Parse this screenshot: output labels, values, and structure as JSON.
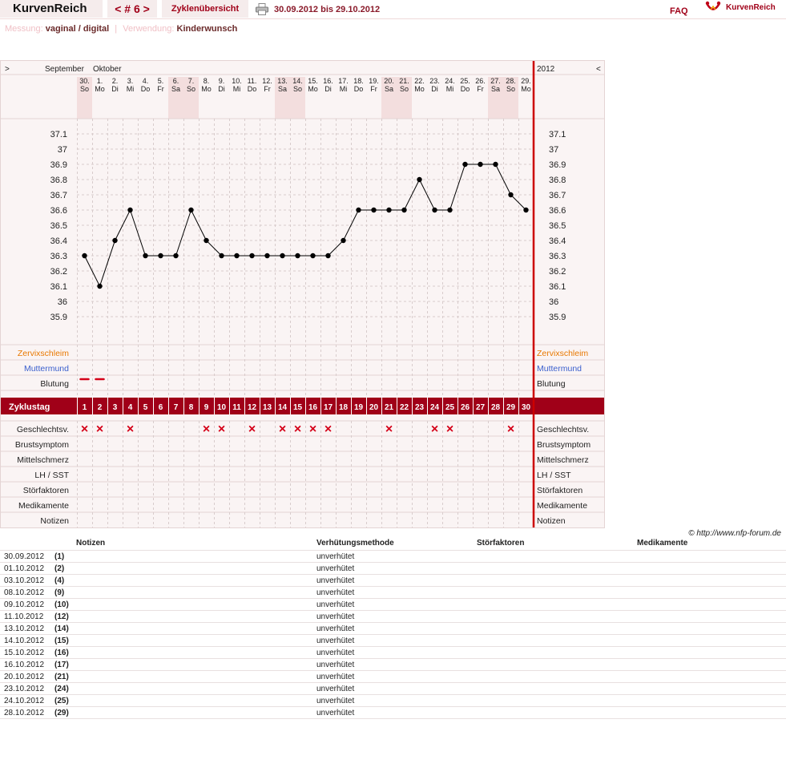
{
  "header": {
    "brand": "KurvenReich",
    "cycle": "< # 6 >",
    "overview": "Zyklenübersicht",
    "range": "30.09.2012 bis 29.10.2012",
    "faq": "FAQ",
    "logo_text": "KurvenReich",
    "printer_icon": "printer-icon",
    "logo_icon": "kurvenreich-logo-icon"
  },
  "meta": {
    "measure_label": "Messung:",
    "measure_value": "vaginal / digital",
    "separator": "|",
    "use_label": "Verwendung:",
    "use_value": "Kinderwunsch"
  },
  "colors": {
    "accent": "#a00018",
    "weekend": "#f3dede",
    "cervical": "#e87800",
    "cervix": "#3a5fcd",
    "curve": "#000000"
  },
  "chart_data": {
    "type": "line",
    "title": "",
    "nav_prev": ">",
    "nav_next": "<",
    "months": [
      "September",
      "Oktober"
    ],
    "year": "2012",
    "dates": [
      "30.",
      "1.",
      "2.",
      "3.",
      "4.",
      "5.",
      "6.",
      "7.",
      "8.",
      "9.",
      "10.",
      "11.",
      "12.",
      "13.",
      "14.",
      "15.",
      "16.",
      "17.",
      "18.",
      "19.",
      "20.",
      "21.",
      "22.",
      "23.",
      "24.",
      "25.",
      "26.",
      "27.",
      "28.",
      "29."
    ],
    "weekdays": [
      "So",
      "Mo",
      "Di",
      "Mi",
      "Do",
      "Fr",
      "Sa",
      "So",
      "Mo",
      "Di",
      "Mi",
      "Do",
      "Fr",
      "Sa",
      "So",
      "Mo",
      "Di",
      "Mi",
      "Do",
      "Fr",
      "Sa",
      "So",
      "Mo",
      "Di",
      "Mi",
      "Do",
      "Fr",
      "Sa",
      "So",
      "Mo"
    ],
    "y_ticks": [
      "37.1",
      "37",
      "36.9",
      "36.8",
      "36.7",
      "36.6",
      "36.5",
      "36.4",
      "36.3",
      "36.2",
      "36.1",
      "36",
      "35.9"
    ],
    "ylim": [
      35.8,
      37.2
    ],
    "x": [
      1,
      2,
      3,
      4,
      5,
      6,
      7,
      8,
      9,
      10,
      11,
      12,
      13,
      14,
      15,
      16,
      17,
      18,
      19,
      20,
      21,
      22,
      23,
      24,
      25,
      26,
      27,
      28,
      29,
      30
    ],
    "series": [
      {
        "values": [
          36.3,
          36.1,
          36.4,
          36.6,
          36.3,
          36.3,
          36.3,
          36.6,
          36.4,
          36.3,
          36.3,
          36.3,
          36.3,
          36.3,
          36.3,
          36.3,
          36.3,
          36.4,
          36.6,
          36.6,
          36.6,
          36.6,
          36.8,
          36.6,
          36.6,
          36.9,
          36.9,
          36.9,
          36.7,
          36.6
        ]
      }
    ],
    "row_labels": {
      "cervical_mucus": "Zervixschleim",
      "cervix": "Muttermund",
      "bleeding": "Blutung",
      "cycle_day": "Zyklustag",
      "intercourse": "Geschlechtsv.",
      "breast": "Brustsymptom",
      "mittelschmerz": "Mittelschmerz",
      "lh": "LH / SST",
      "disturbances": "Störfaktoren",
      "medication": "Medikamente",
      "notes": "Notizen"
    },
    "bleeding_days": [
      1,
      2
    ],
    "intercourse_days": [
      1,
      2,
      4,
      9,
      10,
      12,
      14,
      15,
      16,
      17,
      21,
      24,
      25,
      29
    ],
    "intercourse_mark": "×"
  },
  "copyright": "© http://www.nfp-forum.de",
  "notes_table": {
    "headers": {
      "notes": "Notizen",
      "method": "Verhütungsmethode",
      "disturbances": "Störfaktoren",
      "medication": "Medikamente"
    },
    "rows": [
      {
        "date": "30.09.2012",
        "day": "(1)",
        "method": "unverhütet"
      },
      {
        "date": "01.10.2012",
        "day": "(2)",
        "method": "unverhütet"
      },
      {
        "date": "03.10.2012",
        "day": "(4)",
        "method": "unverhütet"
      },
      {
        "date": "08.10.2012",
        "day": "(9)",
        "method": "unverhütet"
      },
      {
        "date": "09.10.2012",
        "day": "(10)",
        "method": "unverhütet"
      },
      {
        "date": "11.10.2012",
        "day": "(12)",
        "method": "unverhütet"
      },
      {
        "date": "13.10.2012",
        "day": "(14)",
        "method": "unverhütet"
      },
      {
        "date": "14.10.2012",
        "day": "(15)",
        "method": "unverhütet"
      },
      {
        "date": "15.10.2012",
        "day": "(16)",
        "method": "unverhütet"
      },
      {
        "date": "16.10.2012",
        "day": "(17)",
        "method": "unverhütet"
      },
      {
        "date": "20.10.2012",
        "day": "(21)",
        "method": "unverhütet"
      },
      {
        "date": "23.10.2012",
        "day": "(24)",
        "method": "unverhütet"
      },
      {
        "date": "24.10.2012",
        "day": "(25)",
        "method": "unverhütet"
      },
      {
        "date": "28.10.2012",
        "day": "(29)",
        "method": "unverhütet"
      }
    ]
  }
}
